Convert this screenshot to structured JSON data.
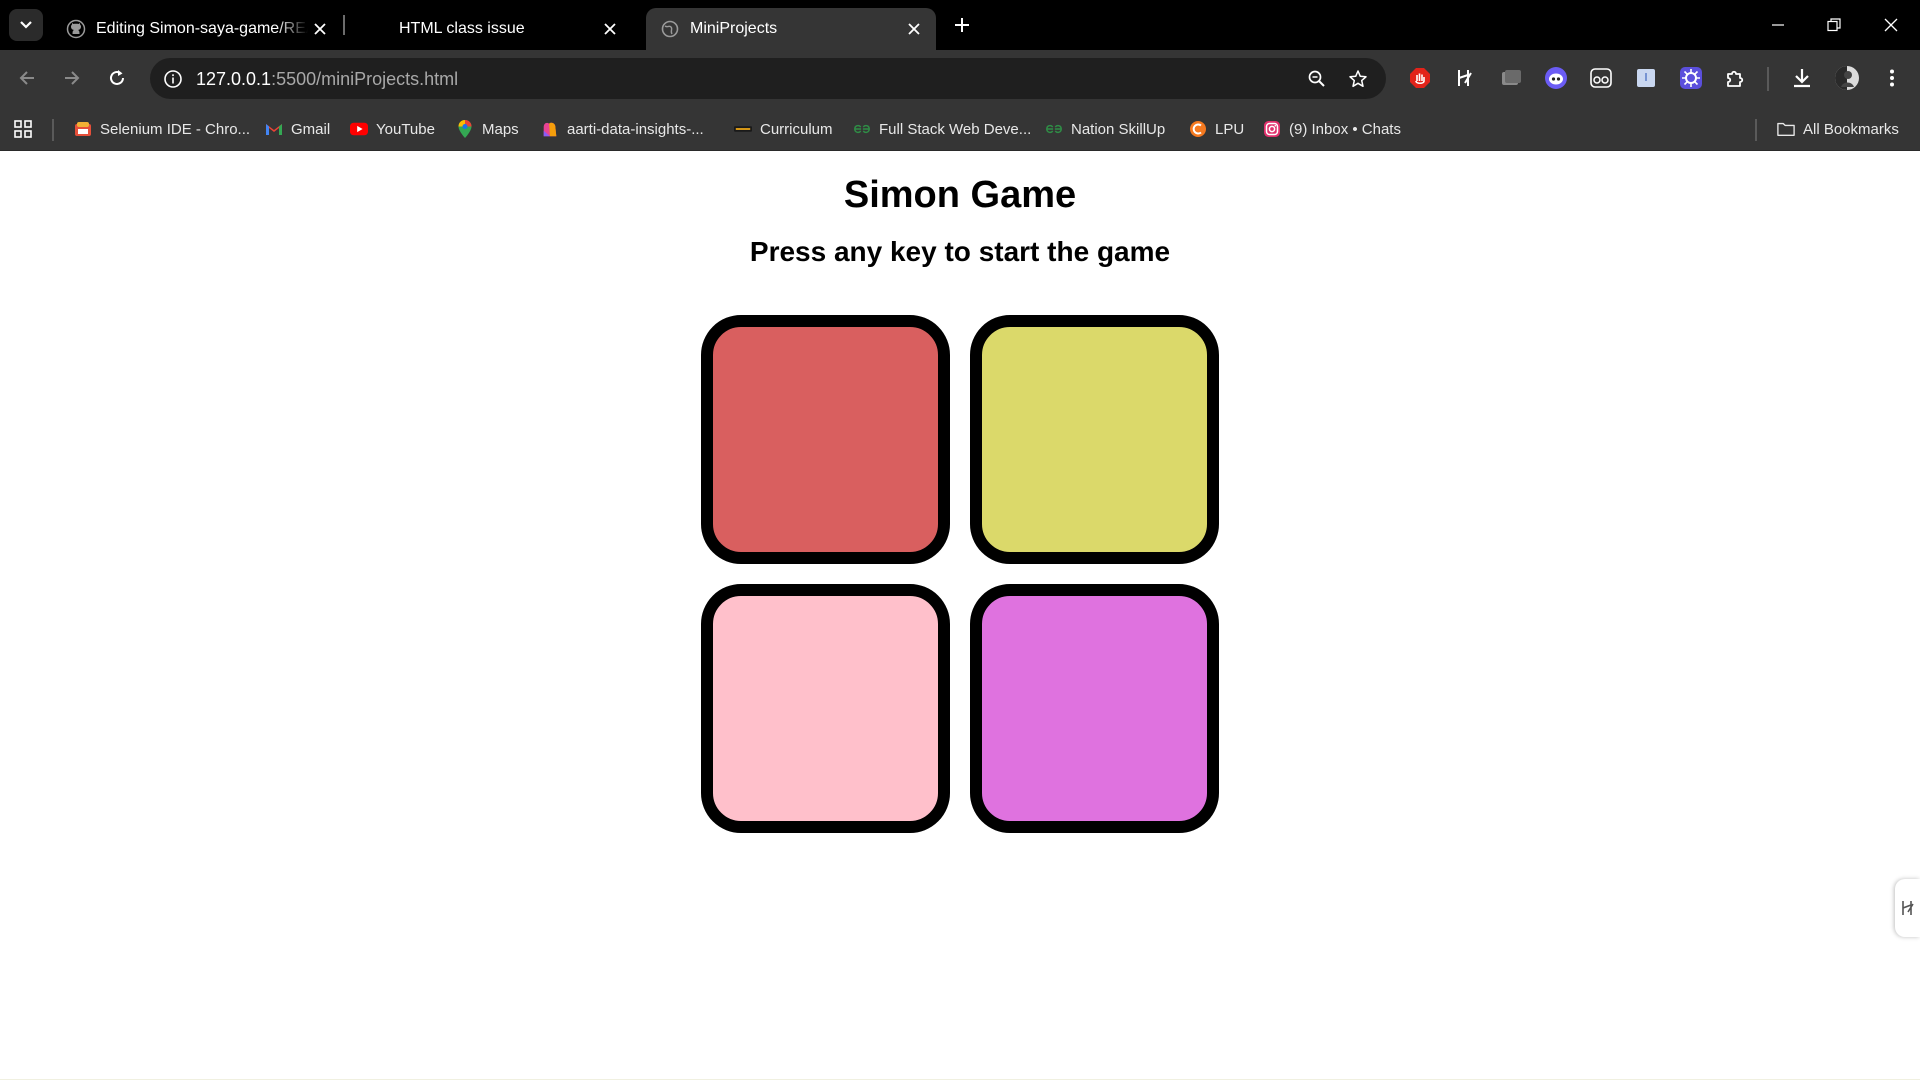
{
  "browser": {
    "tabs": [
      {
        "title": "Editing Simon-saya-game/README",
        "icon": "github-icon",
        "active": false
      },
      {
        "title": "HTML class issue",
        "icon": "none",
        "active": false
      },
      {
        "title": "MiniProjects",
        "icon": "globe-icon",
        "active": true
      }
    ],
    "address": {
      "host": "127.0.0.1",
      "rest": ":5500/miniProjects.html"
    },
    "bookmarks": [
      {
        "label": "Selenium IDE - Chro...",
        "icon": "selenium-icon"
      },
      {
        "label": "Gmail",
        "icon": "gmail-icon"
      },
      {
        "label": "YouTube",
        "icon": "youtube-icon"
      },
      {
        "label": "Maps",
        "icon": "maps-icon"
      },
      {
        "label": "aarti-data-insights-...",
        "icon": "bookmark-app-icon"
      },
      {
        "label": "Curriculum",
        "icon": "curriculum-icon"
      },
      {
        "label": "Full Stack Web Deve...",
        "icon": "gfg-icon"
      },
      {
        "label": "Nation SkillUp",
        "icon": "gfg-icon"
      },
      {
        "label": "LPU",
        "icon": "lpu-icon"
      },
      {
        "label": "(9) Inbox • Chats",
        "icon": "instagram-icon"
      }
    ],
    "all_bookmarks": "All Bookmarks"
  },
  "page": {
    "title": "Simon Game",
    "subtitle": "Press any key to start the game",
    "buttons": [
      {
        "color_name": "red",
        "color": "#d95f5f"
      },
      {
        "color_name": "yellow",
        "color": "#dbd96a"
      },
      {
        "color_name": "pink",
        "color": "#ffc0cb"
      },
      {
        "color_name": "purple",
        "color": "#df72df"
      }
    ]
  },
  "colors": {
    "tab_strip": "#000000",
    "toolbar": "#353535",
    "omnibox": "#1f1f1f",
    "page_bg": "#ffffff"
  }
}
